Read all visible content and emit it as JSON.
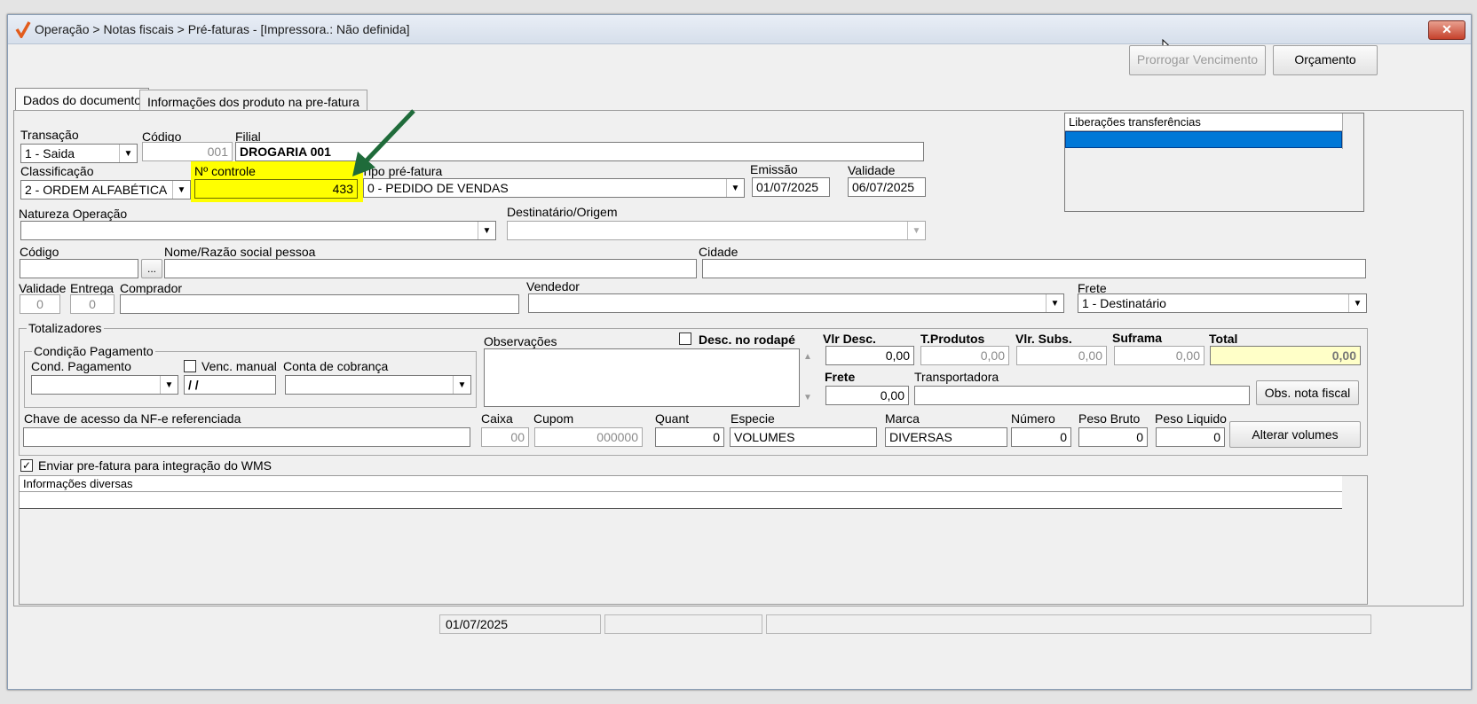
{
  "window": {
    "title": "Operação > Notas fiscais > Pré-faturas - [Impressora.: Não definida]",
    "close_label": "✕"
  },
  "toolbar": {
    "prorrogar": "Prorrogar Vencimento",
    "orcamento": "Orçamento"
  },
  "tabs": [
    {
      "label": "Dados do documento"
    },
    {
      "label": "Informações dos produto na pre-fatura"
    }
  ],
  "liberacoes": {
    "header": "Liberações transferências"
  },
  "form": {
    "transacao": {
      "label": "Transação",
      "value": "1 - Saida"
    },
    "codigo": {
      "label": "Código",
      "value": "001"
    },
    "filial": {
      "label": "Filial",
      "value": "DROGARIA 001"
    },
    "classificacao": {
      "label": "Classificação",
      "value": "2 - ORDEM ALFABÉTICA"
    },
    "n_controle": {
      "label": "Nº controle",
      "value": "433"
    },
    "tipo_prefatura": {
      "label": "Tipo pré-fatura",
      "value": "0 - PEDIDO DE VENDAS"
    },
    "emissao": {
      "label": "Emissão",
      "value": "01/07/2025"
    },
    "validade_data": {
      "label": "Validade",
      "value": "06/07/2025"
    },
    "natureza": {
      "label": "Natureza  Operação",
      "value": ""
    },
    "destinatario": {
      "label": "Destinatário/Origem",
      "value": ""
    },
    "codigo_pessoa": {
      "label": "Código",
      "value": ""
    },
    "dots": "...",
    "nome": {
      "label": "Nome/Razão social pessoa",
      "value": ""
    },
    "cidade": {
      "label": "Cidade",
      "value": ""
    },
    "validade_num": {
      "label": "Validade",
      "value": "0"
    },
    "entrega": {
      "label": "Entrega",
      "value": "0"
    },
    "comprador": {
      "label": "Comprador",
      "value": ""
    },
    "vendedor": {
      "label": "Vendedor",
      "value": ""
    },
    "frete_sel": {
      "label": "Frete",
      "value": "1 - Destinatário"
    }
  },
  "totalizadores": {
    "title": "Totalizadores",
    "condicao": {
      "title": "Condição Pagamento",
      "cond_label": "Cond. Pagamento",
      "venc_label": "Venc. manual",
      "venc_value": "/ /",
      "conta_label": "Conta de cobrança"
    },
    "observacoes_label": "Observações",
    "desc_rodape_label": "Desc. no rodapé",
    "vlr_desc": {
      "label": "Vlr Desc.",
      "value": "0,00"
    },
    "t_produtos": {
      "label": "T.Produtos",
      "value": "0,00"
    },
    "vlr_subs": {
      "label": "Vlr. Subs.",
      "value": "0,00"
    },
    "suframa": {
      "label": "Suframa",
      "value": "0,00"
    },
    "total": {
      "label": "Total",
      "value": "0,00"
    },
    "frete": {
      "label": "Frete",
      "value": "0,00"
    },
    "transportadora": {
      "label": "Transportadora",
      "value": ""
    },
    "obs_nota_fiscal": "Obs. nota fiscal",
    "chave": {
      "label": "Chave de acesso da NF-e referenciada",
      "value": ""
    },
    "caixa": {
      "label": "Caixa",
      "value": "00"
    },
    "cupom": {
      "label": "Cupom",
      "value": "000000"
    },
    "quant": {
      "label": "Quant",
      "value": "0"
    },
    "especie": {
      "label": "Especie",
      "value": "VOLUMES"
    },
    "marca": {
      "label": "Marca",
      "value": "DIVERSAS"
    },
    "numero": {
      "label": "Número",
      "value": "0"
    },
    "peso_bruto": {
      "label": "Peso Bruto",
      "value": "0"
    },
    "peso_liquido": {
      "label": "Peso Liquido",
      "value": "0"
    },
    "alterar_volumes": "Alterar volumes"
  },
  "wms": {
    "label": "Enviar pre-fatura para integração do WMS",
    "checked": "✓"
  },
  "info_diversas": {
    "header": "Informações diversas"
  },
  "statusbar": {
    "date": "01/07/2025"
  },
  "colors": {
    "highlight": "#ffff00",
    "arrow": "#1f6b3a",
    "selection": "#0078d7",
    "total_bg": "#ffffc8"
  },
  "icons": [
    "logo-icon",
    "close-icon",
    "chevron-down-icon",
    "arrow-annotation-icon",
    "scroll-up-icon",
    "scroll-down-icon",
    "mouse-cursor-icon"
  ]
}
